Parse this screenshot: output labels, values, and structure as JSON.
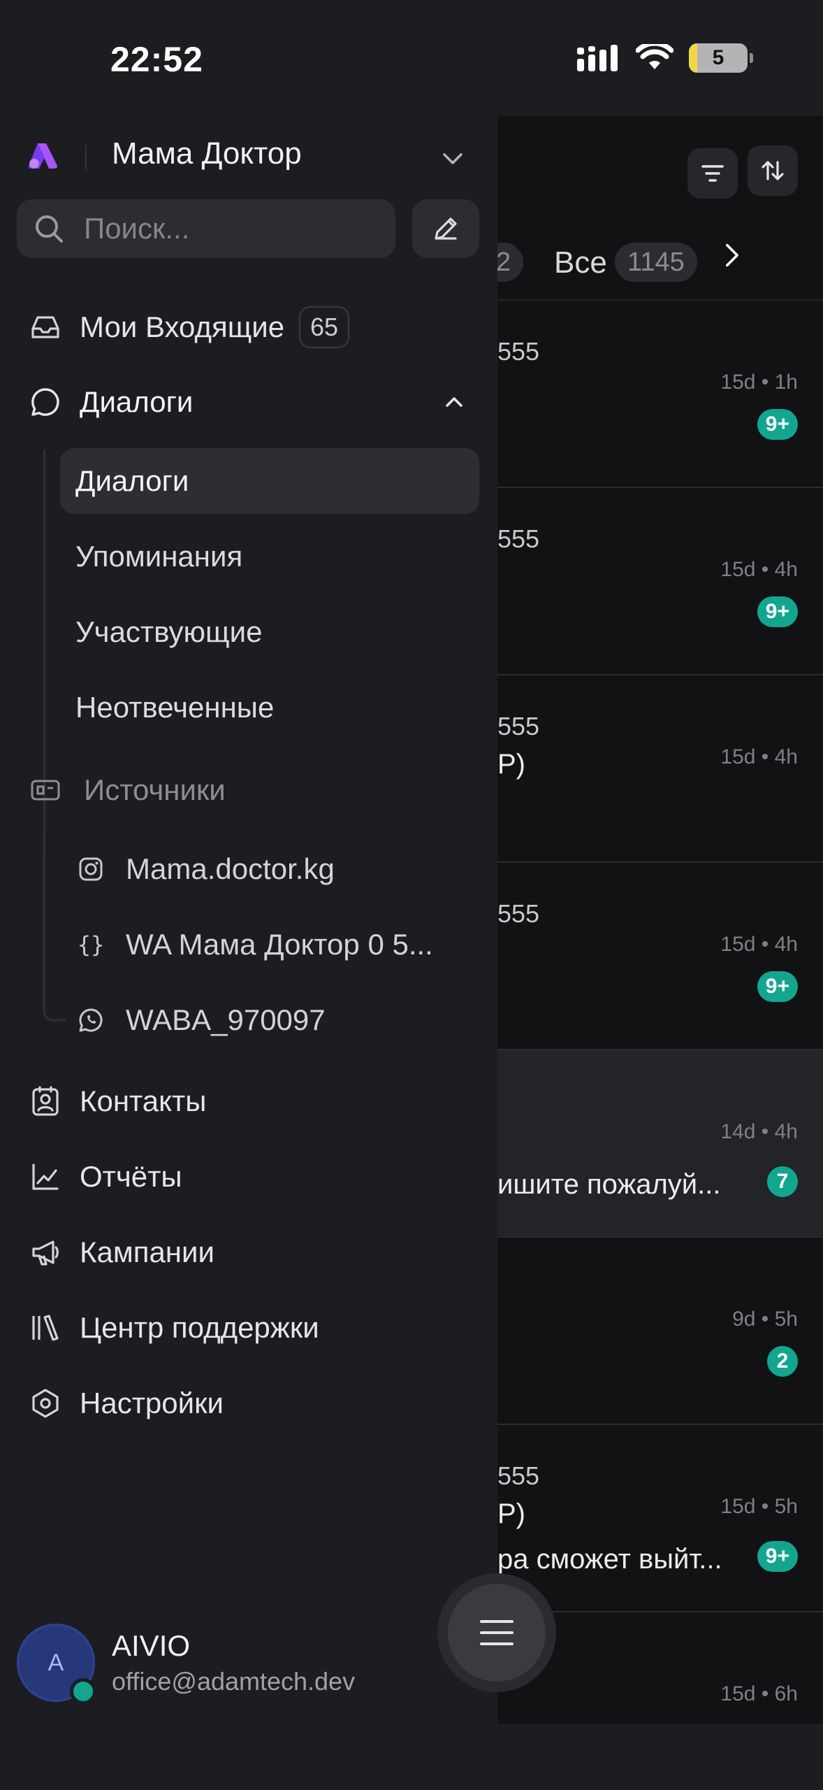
{
  "status_bar": {
    "time": "22:52",
    "battery": "5"
  },
  "workspace": {
    "name": "Мама Доктор"
  },
  "search": {
    "placeholder": "Поиск..."
  },
  "nav": {
    "my_inbox": {
      "label": "Мои Входящие",
      "count": "65"
    },
    "dialogs": {
      "label": "Диалоги"
    },
    "dialog_sub": [
      {
        "label": "Диалоги"
      },
      {
        "label": "Упоминания"
      },
      {
        "label": "Участвующие"
      },
      {
        "label": "Неотвеченные"
      }
    ],
    "sources": {
      "label": "Источники"
    },
    "inboxes": [
      {
        "label": "Mama.doctor.kg",
        "icon": "instagram-icon"
      },
      {
        "label": "WA Мама Доктор 0 5...",
        "icon": "api-braces-icon"
      },
      {
        "label": "WABA_970097",
        "icon": "whatsapp-icon"
      }
    ],
    "contacts": {
      "label": "Контакты"
    },
    "reports": {
      "label": "Отчёты"
    },
    "campaigns": {
      "label": "Кампании"
    },
    "help_center": {
      "label": "Центр поддержки"
    },
    "settings": {
      "label": "Настройки"
    }
  },
  "profile": {
    "initial": "A",
    "name": "AIVIO",
    "email": "office@adamtech.dev"
  },
  "list": {
    "tabs": {
      "prev_count": "2",
      "all_label": "Все",
      "all_count": "1145"
    },
    "conversations": [
      {
        "phone": "555",
        "subtitle": "",
        "subtitle2": "",
        "time": "15d • 1h",
        "badge": "9+"
      },
      {
        "phone": "555",
        "subtitle": "",
        "subtitle2": "",
        "time": "15d • 4h",
        "badge": "9+"
      },
      {
        "phone": "555",
        "subtitle": "P)",
        "subtitle2": "",
        "time": "15d • 4h",
        "badge": ""
      },
      {
        "phone": "555",
        "subtitle": "",
        "subtitle2": "",
        "time": "15d • 4h",
        "badge": "9+"
      },
      {
        "phone": "",
        "subtitle": "",
        "subtitle2": "ишите пожалуй...",
        "time": "14d • 4h",
        "badge": "7"
      },
      {
        "phone": "",
        "subtitle": "",
        "subtitle2": "",
        "time": "9d • 5h",
        "badge": "2"
      },
      {
        "phone": "555",
        "subtitle": "P)",
        "subtitle2": "ра сможет выйт...",
        "time": "15d • 5h",
        "badge": "9+"
      },
      {
        "phone": "",
        "subtitle": "",
        "subtitle2": "",
        "time": "15d • 6h",
        "badge": ""
      }
    ]
  },
  "colors": {
    "accent": "#12a68f",
    "brand_logo": "#a855f7",
    "background": "#1c1d21"
  }
}
